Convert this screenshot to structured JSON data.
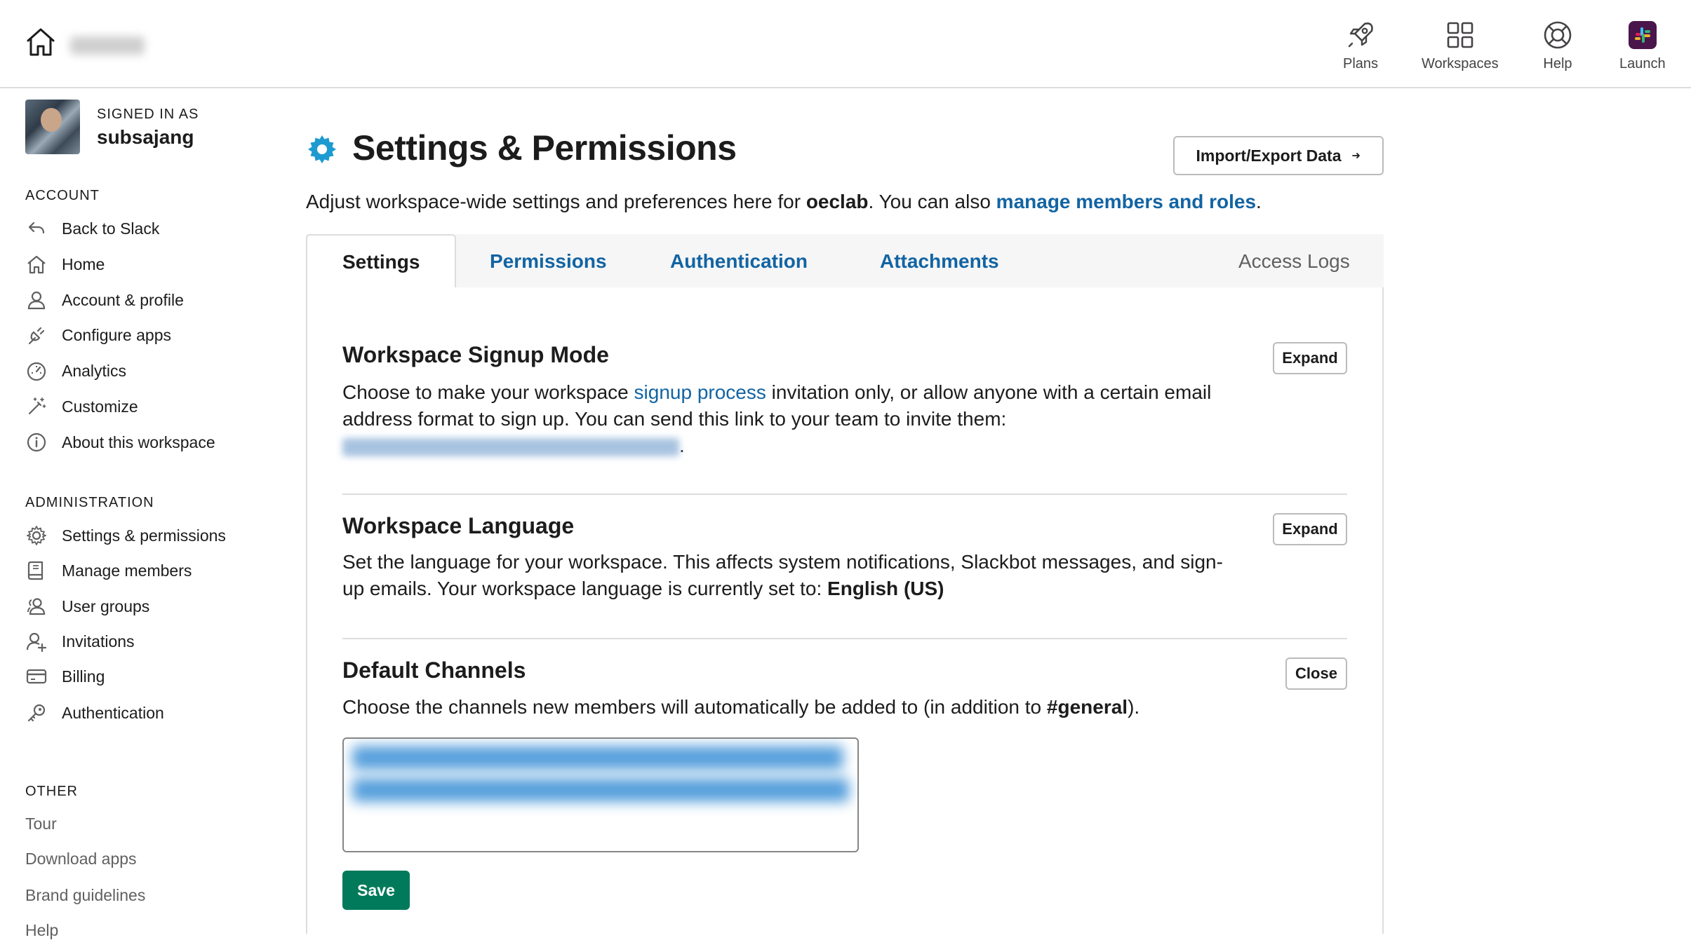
{
  "topbar": {
    "nav": [
      {
        "label": "Plans",
        "icon": "rocket-icon"
      },
      {
        "label": "Workspaces",
        "icon": "grid-icon"
      },
      {
        "label": "Help",
        "icon": "lifebuoy-icon"
      },
      {
        "label": "Launch",
        "icon": "slack-logo-icon"
      }
    ]
  },
  "sidebar": {
    "signed_in_label": "SIGNED IN AS",
    "username": "subsajang",
    "account_heading": "ACCOUNT",
    "account_items": [
      {
        "label": "Back to Slack",
        "icon": "back-arrow-icon"
      },
      {
        "label": "Home",
        "icon": "home-icon"
      },
      {
        "label": "Account & profile",
        "icon": "person-icon"
      },
      {
        "label": "Configure apps",
        "icon": "plug-icon"
      },
      {
        "label": "Analytics",
        "icon": "gauge-icon"
      },
      {
        "label": "Customize",
        "icon": "magic-wand-icon"
      },
      {
        "label": "About this workspace",
        "icon": "info-icon"
      }
    ],
    "admin_heading": "ADMINISTRATION",
    "admin_items": [
      {
        "label": "Settings & permissions",
        "icon": "gear-icon"
      },
      {
        "label": "Manage members",
        "icon": "book-icon"
      },
      {
        "label": "User groups",
        "icon": "users-icon"
      },
      {
        "label": "Invitations",
        "icon": "add-person-icon"
      },
      {
        "label": "Billing",
        "icon": "credit-card-icon"
      },
      {
        "label": "Authentication",
        "icon": "key-icon"
      }
    ],
    "other_heading": "OTHER",
    "other_items": [
      "Tour",
      "Download apps",
      "Brand guidelines",
      "Help"
    ]
  },
  "main": {
    "title": "Settings & Permissions",
    "import_button": "Import/Export Data",
    "subtitle_prefix": "Adjust workspace-wide settings and preferences here for ",
    "workspace": "oeclab",
    "subtitle_mid": ". You can also ",
    "subtitle_link": "manage members and roles",
    "subtitle_end": ".",
    "tabs": [
      "Settings",
      "Permissions",
      "Authentication",
      "Attachments",
      "Access Logs"
    ],
    "sections": {
      "signup": {
        "title": "Workspace Signup Mode",
        "text_1": "Choose to make your workspace ",
        "link": "signup process",
        "text_2": " invitation only, or allow anyone with a certain email address format to sign up. You can send this link to your team to invite them:",
        "text_end": ".",
        "button": "Expand"
      },
      "language": {
        "title": "Workspace Language",
        "text": "Set the language for your workspace. This affects system notifications, Slackbot messages, and sign-up emails. Your workspace language is currently set to: ",
        "value": "English (US)",
        "button": "Expand"
      },
      "channels": {
        "title": "Default Channels",
        "text_1": "Choose the channels new members will automatically be added to (in addition to ",
        "channel": "#general",
        "text_2": ").",
        "button": "Close",
        "save": "Save"
      }
    }
  },
  "colors": {
    "link": "#1264a3",
    "save": "#007a5a",
    "gear": "#1d9bd1"
  }
}
